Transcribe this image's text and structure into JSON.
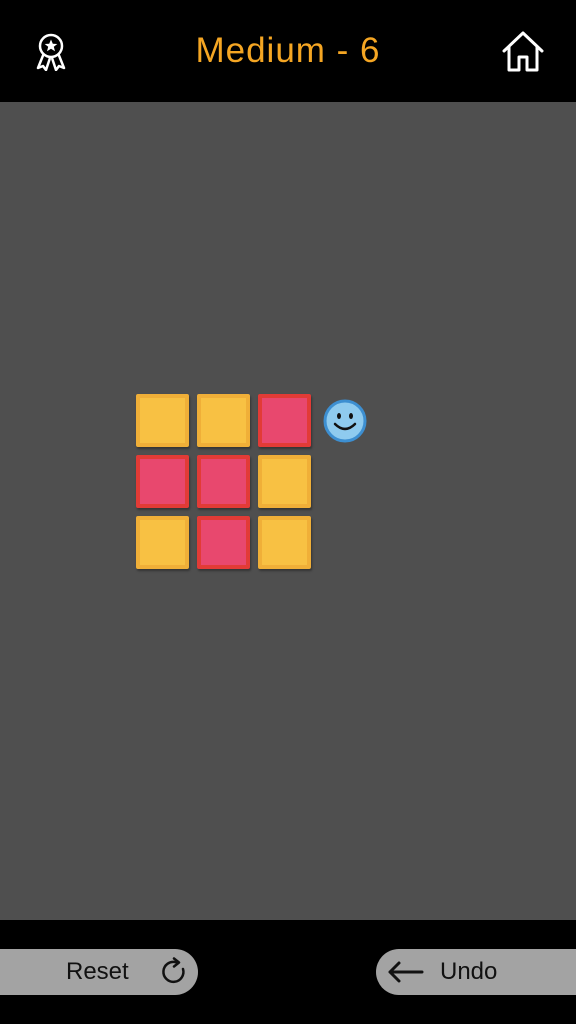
{
  "header": {
    "title": "Medium - 6",
    "left_icon": "award-ribbon-icon",
    "right_icon": "home-icon"
  },
  "board": {
    "background": "#4f4f4f",
    "tiles": [
      {
        "row": 0,
        "col": 0,
        "color": "yellow"
      },
      {
        "row": 0,
        "col": 1,
        "color": "yellow"
      },
      {
        "row": 0,
        "col": 2,
        "color": "red"
      },
      {
        "row": 1,
        "col": 0,
        "color": "red"
      },
      {
        "row": 1,
        "col": 1,
        "color": "red"
      },
      {
        "row": 1,
        "col": 2,
        "color": "yellow"
      },
      {
        "row": 2,
        "col": 0,
        "color": "yellow"
      },
      {
        "row": 2,
        "col": 1,
        "color": "red"
      },
      {
        "row": 2,
        "col": 2,
        "color": "yellow"
      }
    ],
    "player": {
      "row": 0,
      "col": 3,
      "icon": "smiley-face-icon"
    }
  },
  "colors": {
    "accent": "#F5A623",
    "tile_yellow": "#F8C143",
    "tile_red": "#E8486E",
    "player_blue": "#8FCBEF",
    "button_gray": "#a3a3a3"
  },
  "footer": {
    "reset_label": "Reset",
    "reset_icon": "refresh-icon",
    "undo_label": "Undo",
    "undo_icon": "arrow-left-icon"
  }
}
